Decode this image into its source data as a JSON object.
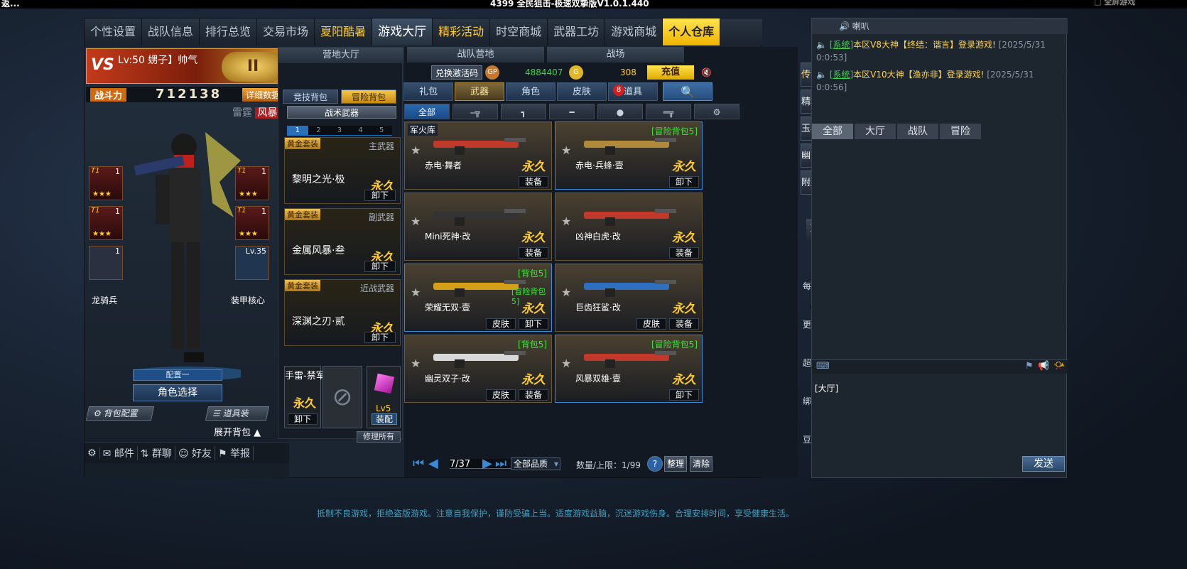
{
  "window": {
    "left_title": "返...",
    "title": "4399 全民狙击-极速双挚版V1.0.1.440",
    "right": "□ 全屏游戏"
  },
  "nav": {
    "tabs": [
      {
        "label": "个性设置",
        "style": "normal"
      },
      {
        "label": "战队信息",
        "style": "normal"
      },
      {
        "label": "排行总览",
        "style": "normal"
      },
      {
        "label": "交易市场",
        "style": "normal"
      },
      {
        "label": "夏阳酷暑",
        "style": "gold"
      },
      {
        "label": "游戏大厅",
        "style": "active"
      },
      {
        "label": "精彩活动",
        "style": "gold"
      },
      {
        "label": "时空商城",
        "style": "normal"
      },
      {
        "label": "武器工坊",
        "style": "normal"
      },
      {
        "label": "游戏商城",
        "style": "normal"
      },
      {
        "label": "个人仓库",
        "style": "warehouse"
      }
    ]
  },
  "character": {
    "vs": "VS",
    "level_name": "Lv:50 娚子】帅气",
    "rank": "II",
    "power_label": "战斗力",
    "power_value": "712138",
    "detail_btn": "详细数据",
    "stance1": "雷霆",
    "stance2": "风暴",
    "gear": [
      {
        "tier": "T1",
        "count": "1",
        "stars": "★★★"
      },
      {
        "tier": "T1",
        "count": "1",
        "stars": "★★★"
      },
      {
        "tier": "T1",
        "count": "1",
        "stars": "★★★"
      },
      {
        "tier": "T1",
        "count": "1",
        "stars": "★★★"
      }
    ],
    "pet_label": "龙骑兵",
    "pet_count": "1",
    "core_label": "装甲核心",
    "core_level": "Lv.35",
    "config": "配置一",
    "role_select": "角色选择",
    "bag_config": "背包配置",
    "items_btn": "道具装",
    "expand": "展开背包 ▲"
  },
  "footer_nav": [
    {
      "label": "邮件"
    },
    {
      "label": "群聊"
    },
    {
      "label": "好友"
    },
    {
      "label": "举报"
    }
  ],
  "backpack": {
    "header": "营地大厅",
    "tab_competitive": "竞技背包",
    "tab_adventure": "冒险背包",
    "tactical": "战术武器",
    "pages": [
      "1",
      "2",
      "3",
      "4",
      "5"
    ],
    "slots": [
      {
        "badge": "黄金套装",
        "type": "主武器",
        "name": "黎明之光·极",
        "perm": "永久",
        "action": "卸下"
      },
      {
        "badge": "黄金套装",
        "type": "副武器",
        "name": "金属风暴·叁",
        "perm": "永久",
        "action": "卸下"
      },
      {
        "badge": "黄金套装",
        "type": "近战武器",
        "name": "深渊之刃·贰",
        "perm": "永久",
        "action": "卸下"
      }
    ],
    "grenade_name": "手雷-禁军",
    "grenade_perm": "永久",
    "grenade_action": "卸下",
    "gem_level": "Lv5",
    "gem_action": "装配",
    "repair": "修理所有"
  },
  "weapons": {
    "header_tabs": [
      "战队营地",
      "战场"
    ],
    "help": "?",
    "code_btn": "兑换激活码",
    "gp_icon": "GP",
    "gp": "4884407",
    "gc_icon": "G",
    "gc": "308",
    "topup": "充值",
    "tabs": [
      {
        "label": "礼包",
        "on": false
      },
      {
        "label": "武器",
        "on": true
      },
      {
        "label": "角色",
        "on": false
      },
      {
        "label": "皮肤",
        "on": false
      },
      {
        "label": "道具",
        "on": false,
        "badge": "8"
      }
    ],
    "search": "🔍",
    "categories": [
      "全部",
      "▾",
      "",
      "",
      "",
      "",
      ""
    ],
    "cards": [
      {
        "name": "赤电·舞者",
        "perm": "永久",
        "label": "军火库",
        "tag": "",
        "tag2": "",
        "actions": [
          "装备"
        ],
        "sel": false,
        "col": "#c0392b"
      },
      {
        "name": "赤电·兵蜂·壹",
        "perm": "永久",
        "label": "",
        "tag": "[冒险背包5]",
        "tag2": "",
        "actions": [
          "卸下"
        ],
        "sel": true,
        "col": "#b08a3a"
      },
      {
        "name": "Mini死神·改",
        "perm": "永久",
        "label": "",
        "tag": "",
        "tag2": "",
        "actions": [
          "装备"
        ],
        "sel": false,
        "col": "#333"
      },
      {
        "name": "凶神白虎·改",
        "perm": "永久",
        "label": "",
        "tag": "",
        "tag2": "",
        "actions": [
          "装备"
        ],
        "sel": false,
        "col": "#c0392b"
      },
      {
        "name": "荣耀无双·壹",
        "perm": "永久",
        "label": "",
        "tag": "[背包5]",
        "tag2": "[冒险背包5]",
        "actions": [
          "皮肤",
          "卸下"
        ],
        "sel": true,
        "col": "#d4a017"
      },
      {
        "name": "巨齿狂鲨·改",
        "perm": "永久",
        "label": "",
        "tag": "",
        "tag2": "",
        "actions": [
          "皮肤",
          "装备"
        ],
        "sel": false,
        "col": "#2e6fbf"
      },
      {
        "name": "幽灵双子·改",
        "perm": "永久",
        "label": "",
        "tag": "[背包5]",
        "tag2": "",
        "actions": [
          "皮肤",
          "装备"
        ],
        "sel": false,
        "col": "#d8d8d8"
      },
      {
        "name": "风暴双雄·壹",
        "perm": "永久",
        "label": "",
        "tag": "[冒险背包5]",
        "tag2": "",
        "actions": [
          "卸下"
        ],
        "sel": true,
        "col": "#c0392b"
      }
    ],
    "page": "7/37",
    "quality": "全部品质",
    "count_label": "数量/上限：1/99",
    "sort_btn": "整理",
    "clear_btn": "清除"
  },
  "side": {
    "buttons": [
      "传说铸造",
      "精粹商店",
      "玉石工坊",
      "幽能军备",
      "附魔工厂"
    ],
    "chat": "聊 天",
    "icons": [
      {
        "label": "每日福利",
        "icon": "✎"
      },
      {
        "label": "更新公告",
        "icon": "💬"
      },
      {
        "label": "超级用户",
        "icon": "👤"
      },
      {
        "label": "绑定手机",
        "icon": "📱"
      },
      {
        "label": "豆娃勋章",
        "icon": "☺"
      }
    ]
  },
  "chat": {
    "header": "喇叭",
    "messages": [
      {
        "sys": "[系统]",
        "text": "本区V8大神【终结：谐言】登录游戏!",
        "ts": "[2025/5/31 0:0:53]"
      },
      {
        "sys": "[系统]",
        "text": "本区V10大神【渔亦非】登录游戏!",
        "ts": "[2025/5/31 0:0:56]"
      }
    ],
    "tabs": [
      "全部",
      "大厅",
      "战队",
      "冒险"
    ],
    "input_prefix": "[大厅]",
    "send": "发送"
  },
  "notice": "抵制不良游戏，拒绝盗版游戏。注意自我保护，谨防受骗上当。适度游戏益脑，沉迷游戏伤身。合理安排时间，享受健康生活。"
}
